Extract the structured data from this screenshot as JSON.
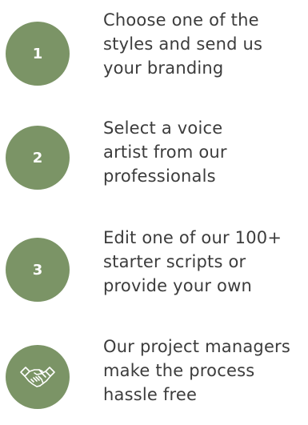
{
  "colors": {
    "circle_fill": "#7b9466",
    "circle_text": "#ffffff",
    "body_text": "#3c3c3c"
  },
  "steps": [
    {
      "badge": "1",
      "lines": [
        "Choose one of the",
        "styles and send us",
        "your branding"
      ]
    },
    {
      "badge": "2",
      "lines": [
        "Select a voice",
        "artist from our",
        "professionals"
      ]
    },
    {
      "badge": "3",
      "lines": [
        "Edit one of our 100+",
        "starter scripts or",
        "provide your own"
      ]
    },
    {
      "icon": "handshake-icon",
      "lines": [
        "Our project managers",
        "make the process",
        "hassle free"
      ]
    }
  ]
}
